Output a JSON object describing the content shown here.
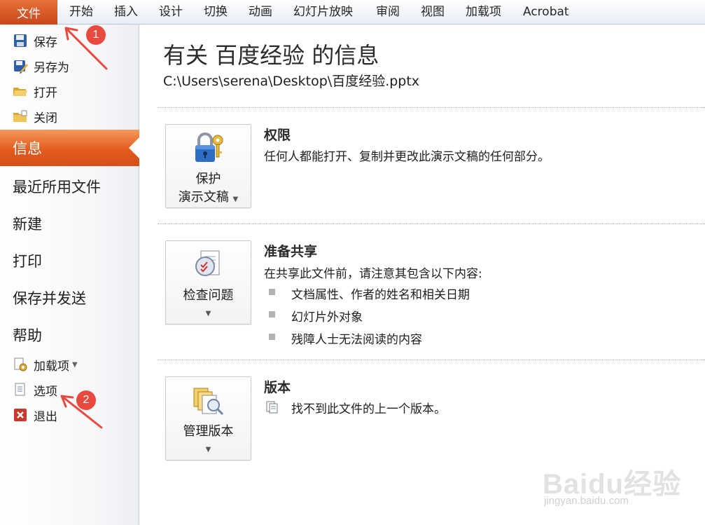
{
  "ribbon": {
    "file_tab": "文件",
    "tabs": [
      "开始",
      "插入",
      "设计",
      "切换",
      "动画",
      "幻灯片放映",
      "审阅",
      "视图",
      "加载项",
      "Acrobat"
    ]
  },
  "backstage": {
    "commands": [
      {
        "label": "保存",
        "icon": "save-icon"
      },
      {
        "label": "另存为",
        "icon": "save-as-icon"
      },
      {
        "label": "打开",
        "icon": "open-folder-icon"
      },
      {
        "label": "关闭",
        "icon": "close-folder-icon"
      }
    ],
    "selected": "信息",
    "items": [
      "最近所用文件",
      "新建",
      "打印",
      "保存并发送",
      "帮助"
    ],
    "bottom_commands": [
      {
        "label": "加载项",
        "icon": "addins-icon",
        "has_dropdown": true
      },
      {
        "label": "选项",
        "icon": "options-icon"
      },
      {
        "label": "退出",
        "icon": "exit-icon"
      }
    ]
  },
  "info": {
    "title": "有关 百度经验 的信息",
    "path": "C:\\Users\\serena\\Desktop\\百度经验.pptx",
    "sections": [
      {
        "button_line1": "保护",
        "button_line2": "演示文稿",
        "heading": "权限",
        "text": "任何人都能打开、复制并更改此演示文稿的任何部分。"
      },
      {
        "button_line1": "检查问题",
        "heading": "准备共享",
        "text": "在共享此文件前，请注意其包含以下内容:",
        "bullets": [
          "文档属性、作者的姓名和相关日期",
          "幻灯片外对象",
          "残障人士无法阅读的内容"
        ]
      },
      {
        "button_line1": "管理版本",
        "heading": "版本",
        "text": "找不到此文件的上一个版本。"
      }
    ]
  },
  "annotations": {
    "badge1": "1",
    "badge2": "2"
  },
  "watermark": {
    "brand": "Baidu经验",
    "url": "jingyan.baidu.com"
  },
  "colors": {
    "accent": "#e35b1e",
    "annotation": "#e84a3f"
  }
}
